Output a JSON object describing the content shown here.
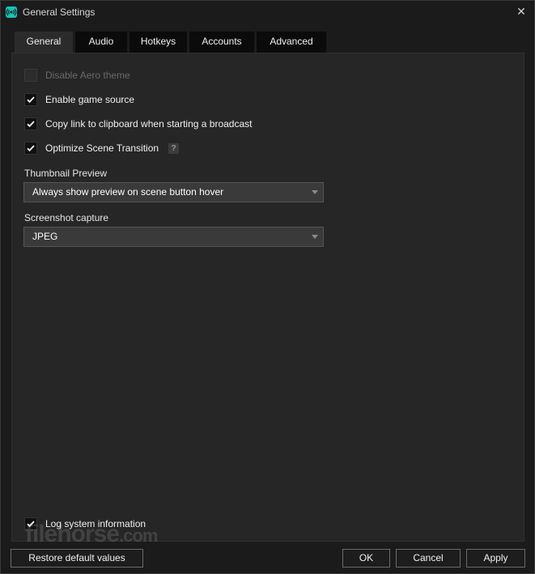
{
  "window": {
    "title": "General Settings",
    "close_glyph": "✕"
  },
  "tabs": [
    {
      "label": "General",
      "active": true
    },
    {
      "label": "Audio",
      "active": false
    },
    {
      "label": "Hotkeys",
      "active": false
    },
    {
      "label": "Accounts",
      "active": false
    },
    {
      "label": "Advanced",
      "active": false
    }
  ],
  "general": {
    "checkboxes": [
      {
        "label": "Disable Aero theme",
        "checked": false,
        "disabled": true
      },
      {
        "label": "Enable game source",
        "checked": true,
        "disabled": false
      },
      {
        "label": "Copy link to clipboard when starting a broadcast",
        "checked": true,
        "disabled": false
      },
      {
        "label": "Optimize Scene Transition",
        "checked": true,
        "disabled": false,
        "help": "?"
      }
    ],
    "thumbnail_preview": {
      "label": "Thumbnail Preview",
      "value": "Always show preview on scene button hover"
    },
    "screenshot_capture": {
      "label": "Screenshot capture",
      "value": "JPEG"
    },
    "log_system": {
      "label": "Log system information",
      "checked": true
    }
  },
  "footer": {
    "restore_label": "Restore default values",
    "ok_label": "OK",
    "cancel_label": "Cancel",
    "apply_label": "Apply"
  },
  "watermark": {
    "main": "filehorse",
    "suffix": ".com"
  },
  "colors": {
    "accent": "#18c3b8",
    "panel": "#262626",
    "background": "#1b1b1b"
  }
}
